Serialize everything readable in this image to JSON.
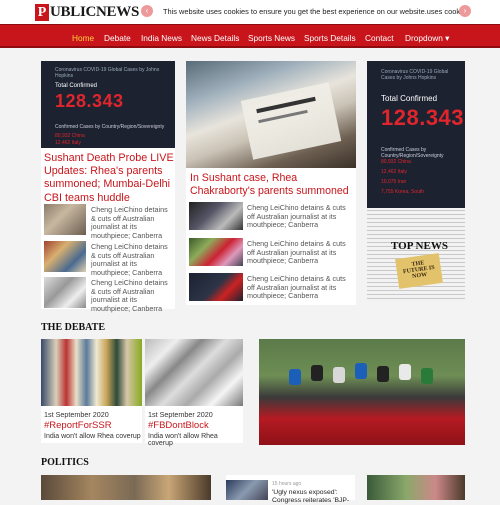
{
  "brand": {
    "initial": "P",
    "rest": "UBLICNEWS"
  },
  "cookie": {
    "text": "This website uses cookies to ensure you get the best experience on our website.uses cookies"
  },
  "nav": {
    "items": [
      "Home",
      "Debate",
      "India News",
      "News Details",
      "Sports News",
      "Sports Details",
      "Contact",
      "Dropdown ▾"
    ]
  },
  "board": {
    "caption": "Coronavirus COVID-19 Global Cases by Johns Hopkins",
    "total_label": "Total Confirmed",
    "total": "128.343",
    "table_label": "Confirmed Cases by Country/Region/Sovereignty",
    "rows": [
      "80,932 China",
      "12,462 Italy",
      "10,075 Iran",
      "7,755 Korea, South"
    ]
  },
  "main_left": {
    "headline": "Sushant Death Probe LIVE Updates: Rhea's parents summoned; Mumbai-Delhi CBI teams huddle"
  },
  "main_center": {
    "headline": "In Sushant case, Rhea Chakraborty's parents summoned"
  },
  "small_story": "Cheng LeiChino detains & cuts off Australian journalist at its mouthpiece; Canberra",
  "top_news": {
    "label": "TOP NEWS",
    "tag": "THE FUTURE IS NOW"
  },
  "sections": {
    "debate": "THE DEBATE",
    "politics": "POLITICS"
  },
  "debate_cards": [
    {
      "date": "1st September 2020",
      "tag": "#ReportForSSR",
      "sub": "India won't allow Rhea coverup"
    },
    {
      "date": "1st September 2020",
      "tag": "#FBDontBlock",
      "sub": "India won't allow Rhea coverup"
    }
  ],
  "politics_snippet": {
    "time": "15 hours ago",
    "text": "'Ugly nexus exposed': Congress reiterates 'BJP-"
  },
  "colors": {
    "brand_red": "#c8151b",
    "nav_active": "#ffd23f",
    "headline_red": "#c8151b"
  }
}
